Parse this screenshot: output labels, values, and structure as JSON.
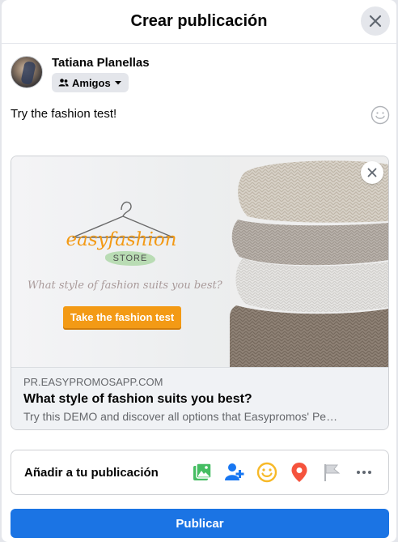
{
  "dialog": {
    "title": "Crear publicación"
  },
  "author": {
    "name": "Tatiana Planellas",
    "audience_label": "Amigos"
  },
  "post": {
    "text": "Try the fashion test!"
  },
  "link_preview": {
    "image": {
      "brand_name": "easyfashion",
      "store_label": "STORE",
      "question": "What style of fashion suits you best?",
      "cta_label": "Take the fashion test"
    },
    "domain": "PR.EASYPROMOSAPP.COM",
    "title": "What style of fashion suits you best?",
    "description": "Try this DEMO and discover all options that Easypromos' Pe…"
  },
  "add_to_post": {
    "label": "Añadir a tu publicación",
    "icons": [
      "photo-video-icon",
      "tag-people-icon",
      "feeling-icon",
      "check-in-icon",
      "flag-icon",
      "more-icon"
    ]
  },
  "actions": {
    "publish_label": "Publicar"
  },
  "colors": {
    "primary": "#1b74e4",
    "photo_green": "#45bd62",
    "tag_blue": "#1877f2",
    "feeling_yellow": "#f7b928",
    "checkin_red": "#f5533d",
    "flag_gray": "#b0b3b8",
    "cta_orange": "#f39a15"
  }
}
